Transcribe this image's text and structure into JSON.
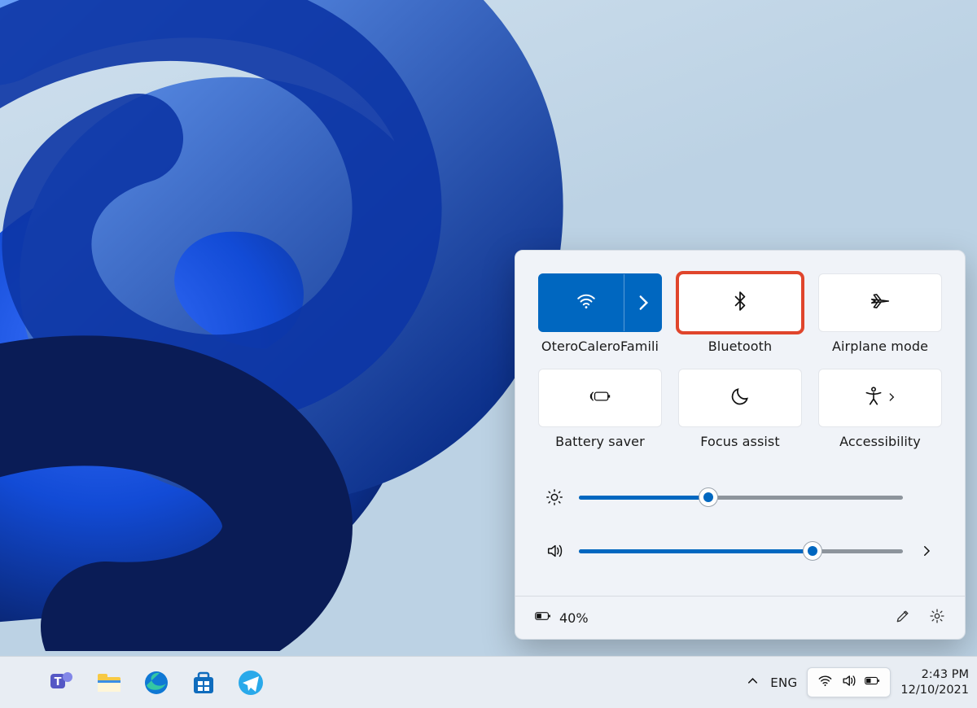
{
  "panel": {
    "tiles": [
      {
        "id": "wifi",
        "label": "OteroCaleroFamili",
        "icon": "wifi-icon",
        "active": true,
        "chevron": true,
        "highlight": false
      },
      {
        "id": "bluetooth",
        "label": "Bluetooth",
        "icon": "bluetooth-icon",
        "active": false,
        "chevron": false,
        "highlight": true
      },
      {
        "id": "airplane",
        "label": "Airplane mode",
        "icon": "airplane-icon",
        "active": false,
        "chevron": false,
        "highlight": false
      },
      {
        "id": "battery",
        "label": "Battery saver",
        "icon": "battery-saver-icon",
        "active": false,
        "chevron": false,
        "highlight": false
      },
      {
        "id": "focus",
        "label": "Focus assist",
        "icon": "moon-icon",
        "active": false,
        "chevron": false,
        "highlight": false
      },
      {
        "id": "access",
        "label": "Accessibility",
        "icon": "accessibility-icon",
        "active": false,
        "chevron": true,
        "highlight": false
      }
    ],
    "brightness_percent": 40,
    "volume_percent": 72,
    "battery_text": "40%"
  },
  "taskbar": {
    "apps": [
      {
        "name": "teams",
        "color1": "#5558c5",
        "color2": "#8287e8"
      },
      {
        "name": "explorer",
        "color1": "#f7c944",
        "color2": "#3a8ee6"
      },
      {
        "name": "edge",
        "color1": "#0f78d4",
        "color2": "#34c6a3"
      },
      {
        "name": "store",
        "color1": "#0f6cbd",
        "color2": "#10427a"
      },
      {
        "name": "telegram",
        "color1": "#29a9ea",
        "color2": "#1c8dca"
      }
    ],
    "language": "ENG",
    "time": "2:43 PM",
    "date": "12/10/2021"
  },
  "colors": {
    "accent": "#0067c0",
    "highlight": "#e0452c"
  }
}
